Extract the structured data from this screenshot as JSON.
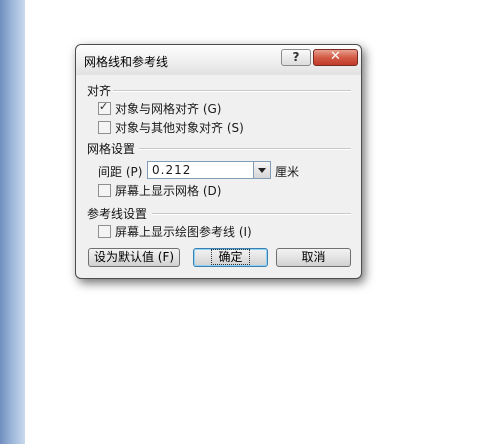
{
  "dialog": {
    "title": "网格线和参考线",
    "help_label": "?",
    "close_label": "✕"
  },
  "align": {
    "heading": "对齐",
    "snap_to_grid": {
      "label": "对象与网格对齐 (G)",
      "checked": true
    },
    "snap_to_objects": {
      "label": "对象与其他对象对齐 (S)",
      "checked": false
    }
  },
  "grid": {
    "heading": "网格设置",
    "spacing_label": "间距 (P) :",
    "spacing_value": "0.212",
    "unit": "厘米",
    "show_grid": {
      "label": "屏幕上显示网格 (D)",
      "checked": false
    }
  },
  "guides": {
    "heading": "参考线设置",
    "show_guides": {
      "label": "屏幕上显示绘图参考线 (I)",
      "checked": false
    }
  },
  "buttons": {
    "set_default": "设为默认值 (F)",
    "ok": "确定",
    "cancel": "取消"
  },
  "icons": {
    "check": "✓"
  }
}
